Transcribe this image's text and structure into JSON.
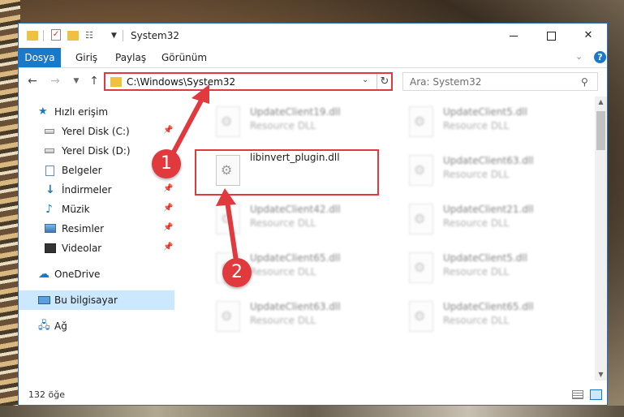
{
  "window": {
    "title": "System32",
    "controls": {
      "minimize": "",
      "maximize": "",
      "close": "✕"
    }
  },
  "ribbon": {
    "tabs": [
      "Dosya",
      "Giriş",
      "Paylaş",
      "Görünüm"
    ],
    "help": "?"
  },
  "navigation": {
    "address": "C:\\Windows\\System32",
    "search_placeholder": "Ara: System32"
  },
  "sidebar": {
    "quick_access": "Hızlı erişim",
    "items": [
      {
        "label": "Yerel Disk (C:)",
        "icon": "drive-icon",
        "pinned": true
      },
      {
        "label": "Yerel Disk (D:)",
        "icon": "drive-icon",
        "pinned": false
      },
      {
        "label": "Belgeler",
        "icon": "documents-icon",
        "pinned": false
      },
      {
        "label": "İndirmeler",
        "icon": "download-icon",
        "pinned": true
      },
      {
        "label": "Müzik",
        "icon": "music-icon",
        "pinned": true
      },
      {
        "label": "Resimler",
        "icon": "pictures-icon",
        "pinned": true
      },
      {
        "label": "Videolar",
        "icon": "videos-icon",
        "pinned": true
      }
    ],
    "onedrive": "OneDrive",
    "this_pc": "Bu bilgisayar",
    "network": "Ağ"
  },
  "files": [
    {
      "name": "UpdateClient19.dll",
      "type": "Resource DLL"
    },
    {
      "name": "UpdateClient5.dll",
      "type": "Resource DLL"
    },
    {
      "name": "libinvert_plugin.dll",
      "type": ""
    },
    {
      "name": "UpdateClient63.dll",
      "type": "Resource DLL"
    },
    {
      "name": "UpdateClient42.dll",
      "type": "Resource DLL"
    },
    {
      "name": "UpdateClient21.dll",
      "type": "Resource DLL"
    },
    {
      "name": "UpdateClient65.dll",
      "type": "Resource DLL"
    },
    {
      "name": "UpdateClient5.dll",
      "type": "Resource DLL"
    },
    {
      "name": "UpdateClient63.dll",
      "type": "Resource DLL"
    },
    {
      "name": "UpdateClient65.dll",
      "type": "Resource DLL"
    }
  ],
  "status": {
    "count": "132 öğe"
  },
  "annotations": {
    "step1": "1",
    "step2": "2"
  },
  "colors": {
    "accent": "#1979ca",
    "highlight": "#e0393e",
    "selection": "#cce8ff"
  }
}
